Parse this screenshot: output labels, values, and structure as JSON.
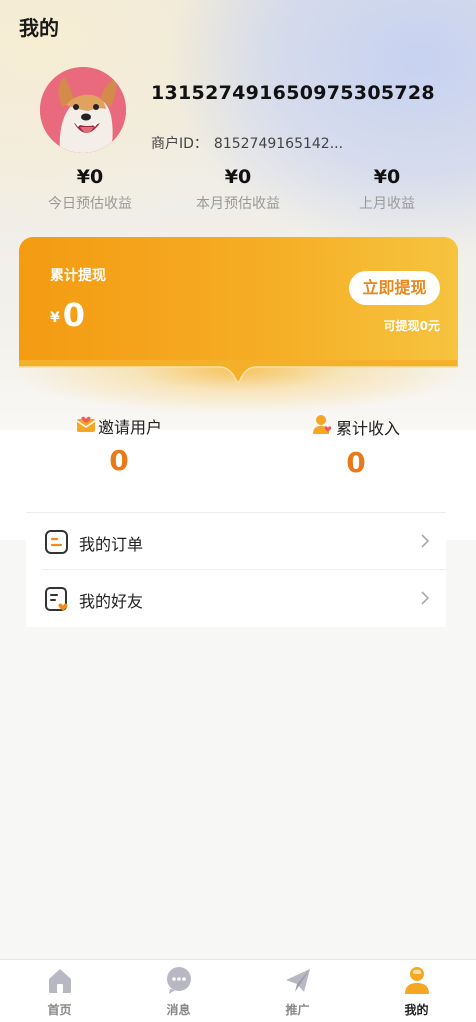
{
  "header": {
    "title": "我的"
  },
  "profile": {
    "username": "13152749165097530572​8",
    "merchant_label": "商户ID：",
    "merchant_id": "8152749165142..."
  },
  "stats": [
    {
      "value": "¥0",
      "label": "今日预估收益"
    },
    {
      "value": "¥0",
      "label": "本月预估收益"
    },
    {
      "value": "¥0",
      "label": "上月收益"
    }
  ],
  "withdraw_card": {
    "title": "累计提现",
    "currency": "¥",
    "amount": "0",
    "button_label": "立即提现",
    "available_text": "可提现0元"
  },
  "summary": [
    {
      "label": "邀请用户",
      "value": "0",
      "icon": "mail-heart-icon"
    },
    {
      "label": "累计收入",
      "value": "0",
      "icon": "user-heart-icon"
    }
  ],
  "menu": [
    {
      "label": "我的订单",
      "icon": "order-icon"
    },
    {
      "label": "我的好友",
      "icon": "friends-icon"
    }
  ],
  "tabbar": [
    {
      "label": "首页",
      "icon": "home-icon",
      "active": false
    },
    {
      "label": "消息",
      "icon": "message-icon",
      "active": false
    },
    {
      "label": "推广",
      "icon": "paper-plane-icon",
      "active": false
    },
    {
      "label": "我的",
      "icon": "profile-icon",
      "active": true
    }
  ],
  "colors": {
    "accent": "#f49b12",
    "value_orange": "#e97a19",
    "tab_inactive": "#b8b8c4"
  }
}
